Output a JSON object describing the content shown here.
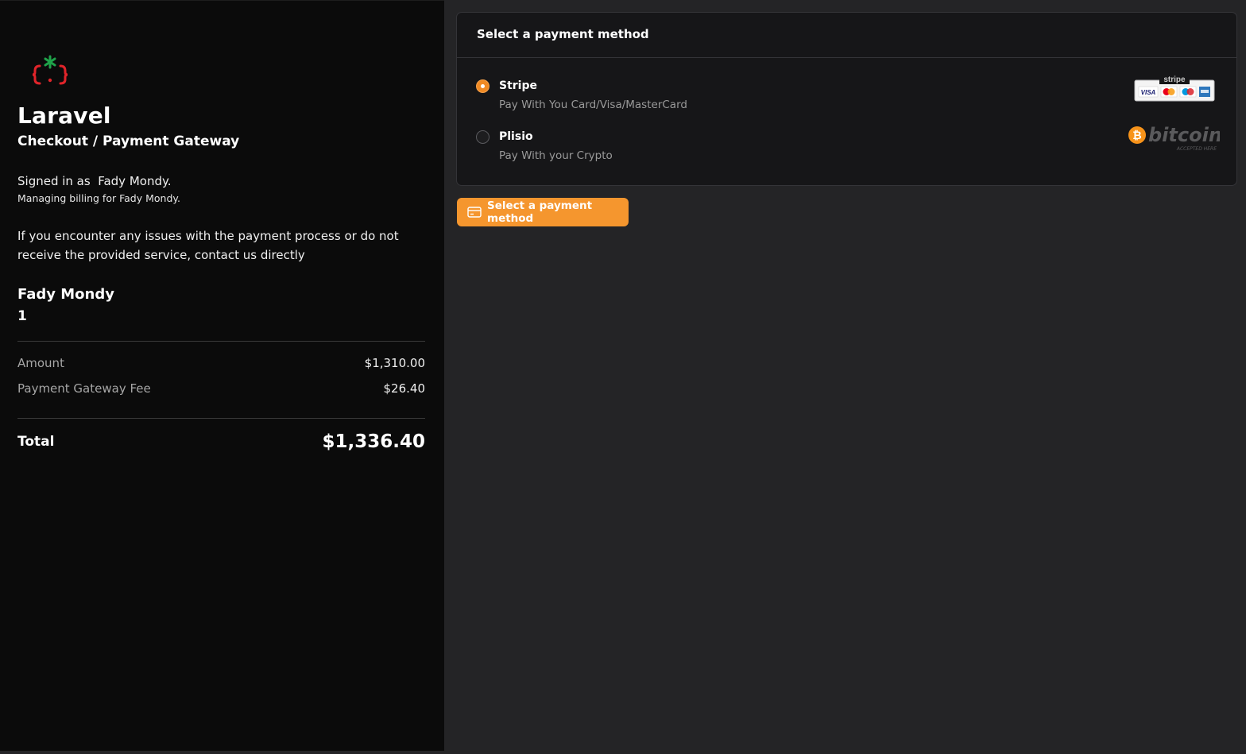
{
  "brand": {
    "title": "Laravel",
    "subtitle": "Checkout / Payment Gateway"
  },
  "account": {
    "signed_in": "Signed in as  Fady Mondy.",
    "managing": "Managing billing for Fady Mondy.",
    "issues": "If you encounter any issues with the payment process or do not receive the provided service, contact us directly"
  },
  "customer": {
    "name": "Fady Mondy",
    "id": "1"
  },
  "summary": {
    "amount_label": "Amount",
    "amount_value": "$1,310.00",
    "fee_label": "Payment Gateway Fee",
    "fee_value": "$26.40",
    "total_label": "Total",
    "total_value": "$1,336.40"
  },
  "payment": {
    "header": "Select a payment method",
    "methods": [
      {
        "title": "Stripe",
        "desc": "Pay With You Card/Visa/MasterCard",
        "selected": true,
        "logo_icon": "stripe-cards-logo"
      },
      {
        "title": "Plisio",
        "desc": "Pay With your Crypto",
        "selected": false,
        "logo_icon": "bitcoin-logo"
      }
    ],
    "button_label": "Select a payment method"
  },
  "logos": {
    "stripe_word": "stripe",
    "visa": "VISA",
    "bitcoin_word": "bitcoin",
    "bitcoin_tag": "ACCEPTED HERE"
  },
  "colors": {
    "accent": "#f5962e",
    "sidebar_bg": "#0b0b0b",
    "main_bg": "#242426",
    "card_bg": "#161618"
  }
}
